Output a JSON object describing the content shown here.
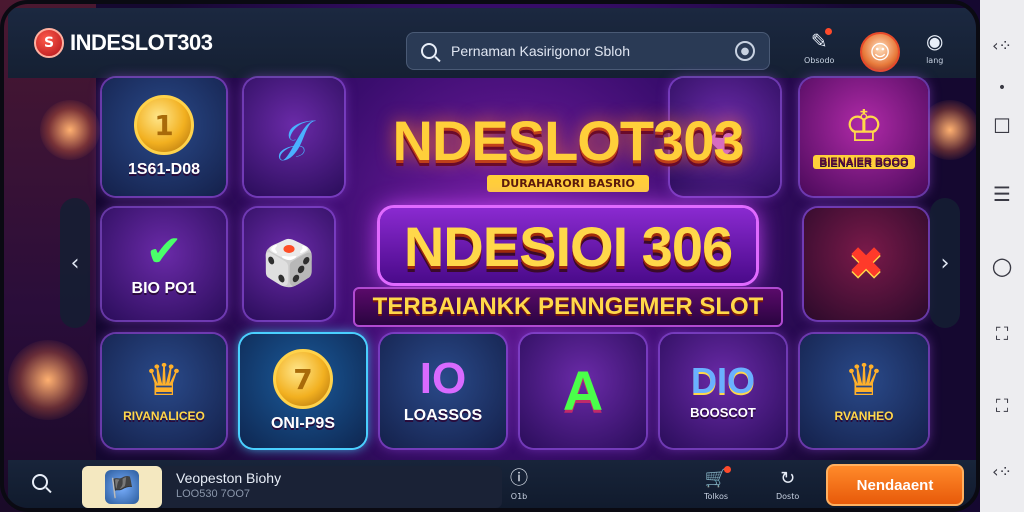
{
  "header": {
    "logo_mark": "S",
    "logo_text": "INDESLOT303",
    "search_placeholder": "Pernaman Kasirigonor Sbloh",
    "icons": [
      {
        "name": "pin-icon",
        "glyph": "✎",
        "label": "Obsodo"
      },
      {
        "name": "bookmark-icon",
        "glyph": "◉",
        "label": "lang"
      }
    ],
    "avatar_glyph": "☺"
  },
  "tiles": [
    {
      "id": "tile-1",
      "art": "coin",
      "art_text": "1",
      "caption": "1S61-D08"
    },
    {
      "id": "tile-2",
      "art": "glyph",
      "art_text": "𝒥",
      "caption": ""
    },
    {
      "id": "tile-3",
      "art": "glyph",
      "art_text": "◆",
      "caption": ""
    },
    {
      "id": "tile-4",
      "art": "glyph",
      "art_text": "♔",
      "caption": "BIENAIER BOOO"
    },
    {
      "id": "tile-5",
      "art": "glyph",
      "art_text": "✔",
      "caption": "BIO PO1"
    },
    {
      "id": "tile-6",
      "art": "glyph",
      "art_text": "🎲",
      "caption": ""
    },
    {
      "id": "tile-7",
      "art": "glyph",
      "art_text": "✖",
      "caption": ""
    },
    {
      "id": "tile-8",
      "art": "glyph",
      "art_text": "♛",
      "caption": "RIVANALICEO"
    },
    {
      "id": "tile-9",
      "art": "coin",
      "art_text": "7",
      "caption": "ONI-P9S"
    },
    {
      "id": "tile-10",
      "art": "glyph",
      "art_text": "IO",
      "caption": "LOASSOS"
    },
    {
      "id": "tile-11",
      "art": "glyph",
      "art_text": "A",
      "caption": ""
    },
    {
      "id": "tile-12",
      "art": "glyph",
      "art_text": "DIO",
      "caption": "BOOSCOT"
    },
    {
      "id": "tile-13",
      "art": "glyph",
      "art_text": "♛",
      "caption": "RVANHEO"
    }
  ],
  "banner": {
    "title1": "NDESLOT303",
    "subtitle1": "DURAHARORI BASRIO",
    "title2": "NDESIOI 306",
    "tagline": "TERBAIANKK PENNGEMER SLOT"
  },
  "nav": {
    "prev": "‹",
    "next": "›"
  },
  "bottom": {
    "game_thumb": "🏴",
    "game_name": "Veopeston Biohy",
    "game_id": "LOO530 7OO7",
    "icons": [
      {
        "name": "info-icon",
        "glyph": "ⓘ",
        "label": "O1b"
      },
      {
        "name": "cart-icon",
        "glyph": "🛒",
        "label": "Tolkos"
      },
      {
        "name": "refresh-icon",
        "glyph": "↻",
        "label": "Dosto"
      }
    ],
    "cta_label": "Nendaaent"
  },
  "system_bar": [
    {
      "name": "back-icon",
      "glyph": "‹⁘"
    },
    {
      "name": "dot-icon",
      "glyph": "•"
    },
    {
      "name": "square-icon",
      "glyph": "☐"
    },
    {
      "name": "menu-icon",
      "glyph": "☰"
    },
    {
      "name": "home-icon",
      "glyph": "○"
    },
    {
      "name": "frame-icon",
      "glyph": "⛶"
    },
    {
      "name": "frame2-icon",
      "glyph": "⛶"
    },
    {
      "name": "back2-icon",
      "glyph": "‹⁘"
    }
  ]
}
